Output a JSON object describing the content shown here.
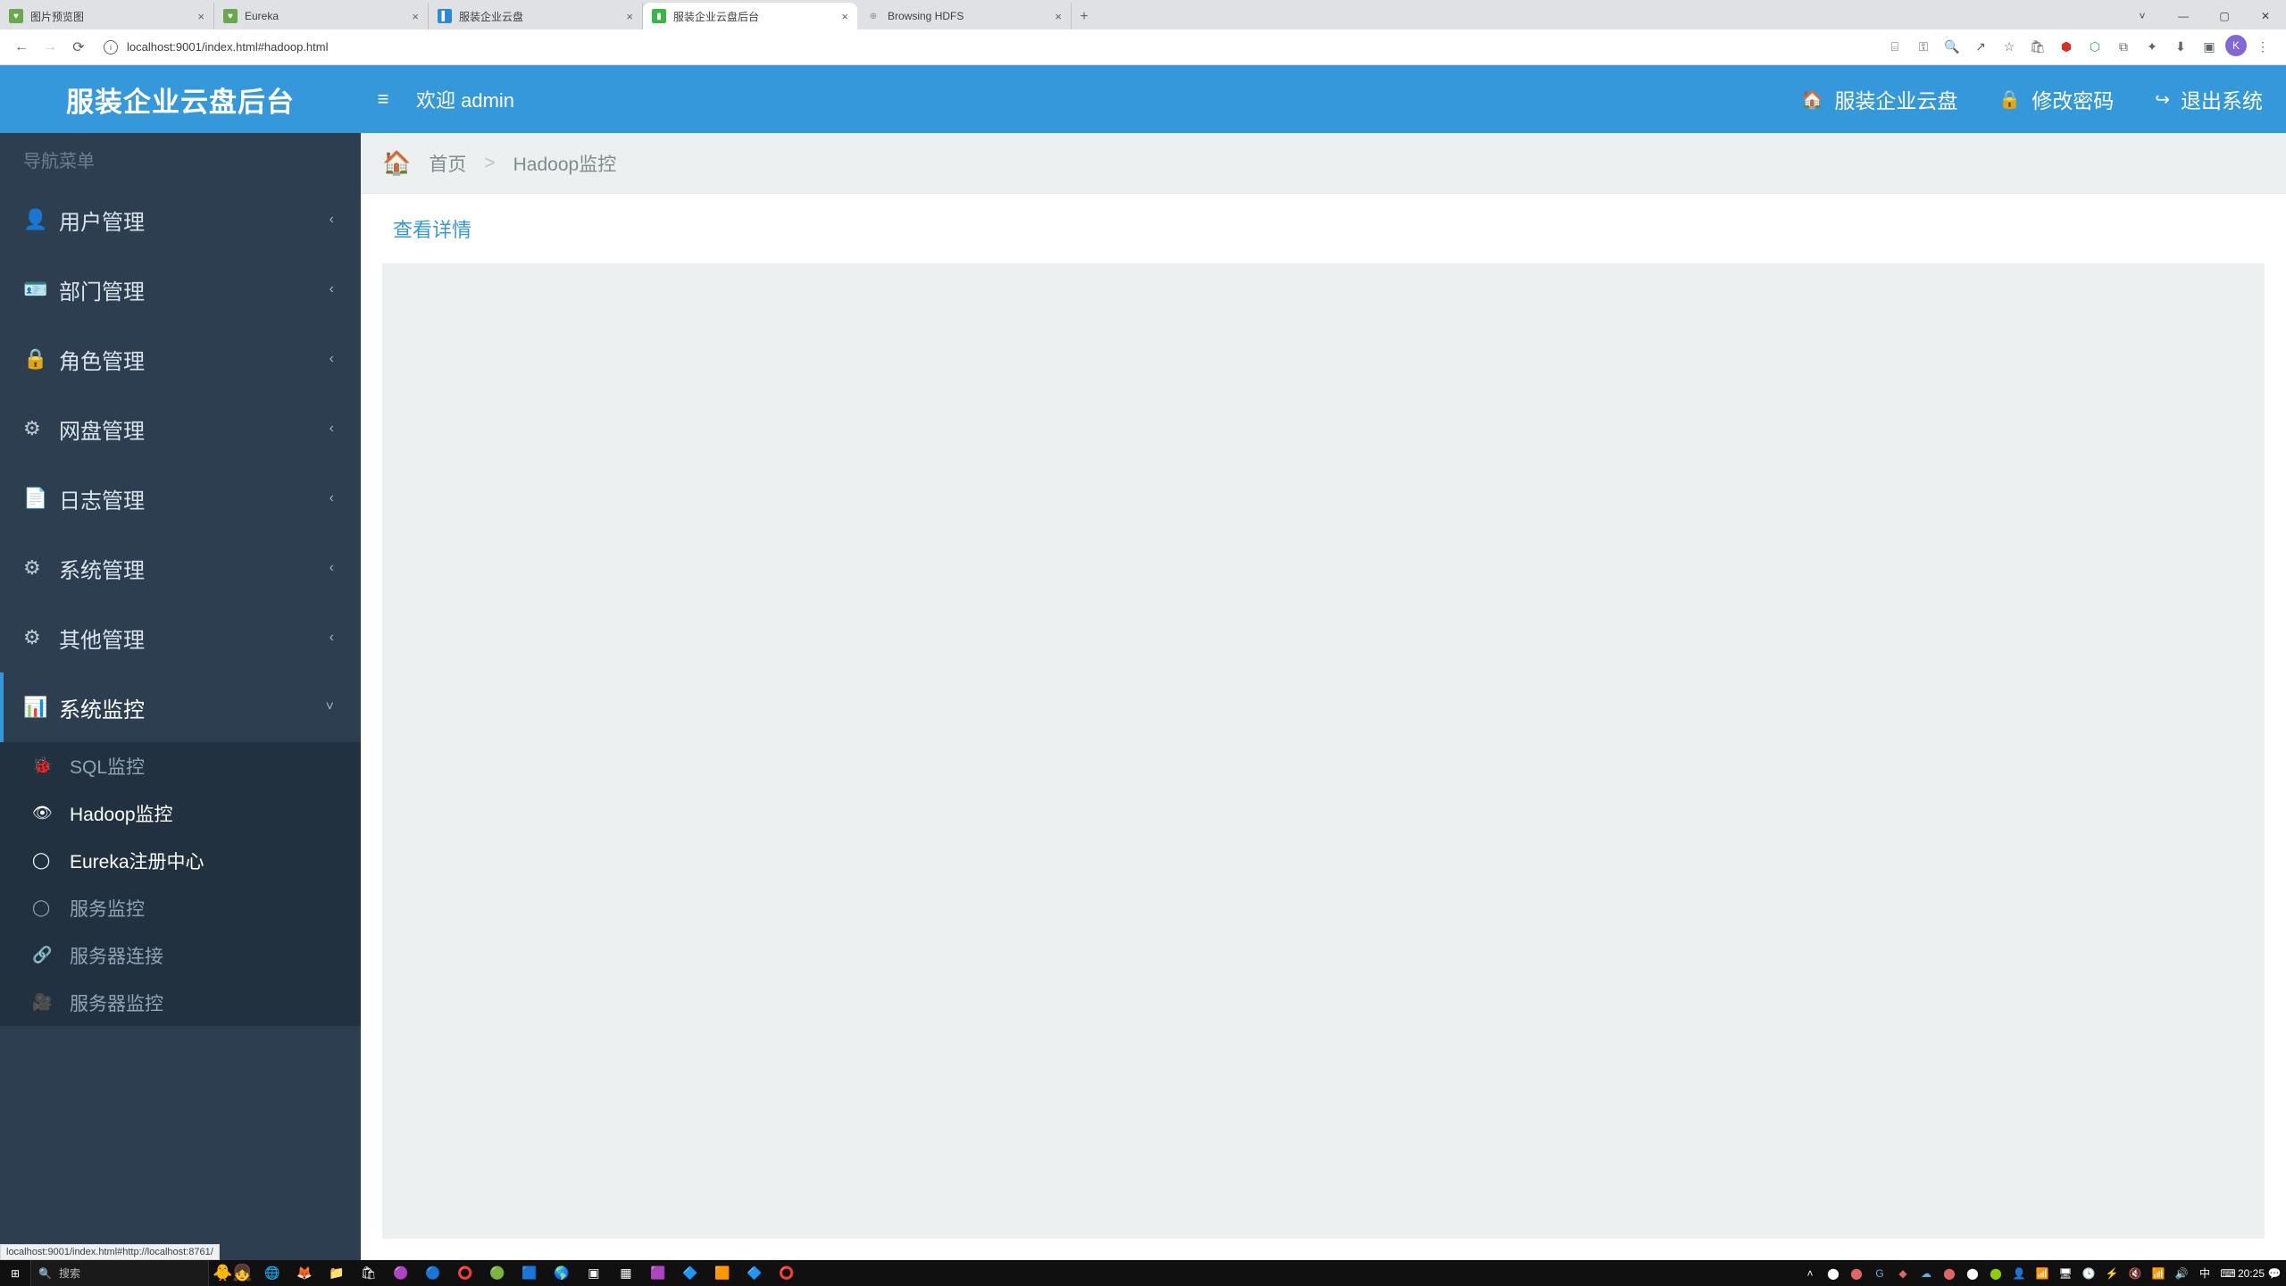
{
  "browser": {
    "tabs": [
      {
        "title": "图片预览图",
        "fav_color": "#6aa84f"
      },
      {
        "title": "Eureka",
        "fav_color": "#6aa84f"
      },
      {
        "title": "服装企业云盘",
        "fav_color": "#2f88d6"
      },
      {
        "title": "服装企业云盘后台",
        "fav_color": "#3bb54a",
        "active": true
      },
      {
        "title": "Browsing HDFS",
        "fav_color": "#888"
      }
    ],
    "url": "localhost:9001/index.html#hadoop.html",
    "win": {
      "min": "—",
      "max": "▢",
      "close": "✕",
      "down": "˅"
    },
    "status_url": "localhost:9001/index.html#http://localhost:8761/"
  },
  "topbar": {
    "logo": "服装企业云盘后台",
    "welcome": "欢迎 admin",
    "right": [
      {
        "icon": "home",
        "label": "服装企业云盘"
      },
      {
        "icon": "lock",
        "label": "修改密码"
      },
      {
        "icon": "logout",
        "label": "退出系统"
      }
    ]
  },
  "sidebar": {
    "title": "导航菜单",
    "items": [
      {
        "icon": "user",
        "label": "用户管理"
      },
      {
        "icon": "idcard",
        "label": "部门管理"
      },
      {
        "icon": "lock2",
        "label": "角色管理"
      },
      {
        "icon": "gear",
        "label": "网盘管理"
      },
      {
        "icon": "file",
        "label": "日志管理"
      },
      {
        "icon": "gear",
        "label": "系统管理"
      },
      {
        "icon": "gear",
        "label": "其他管理"
      },
      {
        "icon": "chart",
        "label": "系统监控",
        "open": true
      }
    ],
    "monitor_sub": [
      {
        "icon": "bug",
        "label": "SQL监控"
      },
      {
        "icon": "eye",
        "label": "Hadoop监控",
        "active": true
      },
      {
        "icon": "circle",
        "label": "Eureka注册中心",
        "hover": true
      },
      {
        "icon": "circle",
        "label": "服务监控"
      },
      {
        "icon": "link",
        "label": "服务器连接"
      },
      {
        "icon": "video",
        "label": "服务器监控"
      }
    ]
  },
  "breadcrumb": {
    "home": "首页",
    "sep": ">",
    "current": "Hadoop监控"
  },
  "content": {
    "heading": "查看详情"
  },
  "taskbar": {
    "search_placeholder": "搜索",
    "ime": "中",
    "time": "20:25"
  },
  "icons": {
    "user": "👤",
    "idcard": "🪪",
    "lock2": "🔒",
    "gear": "⚙",
    "file": "📄",
    "chart": "📊",
    "bug": "🐞",
    "eye": "👁",
    "circle": "◯",
    "link": "🔗",
    "video": "🎥",
    "home": "🏠",
    "lock": "🔒",
    "logout": "↪",
    "menu": "≡",
    "chev_left": "‹",
    "chev_down": "˅",
    "back": "←",
    "fwd": "→",
    "reload": "⟳"
  }
}
